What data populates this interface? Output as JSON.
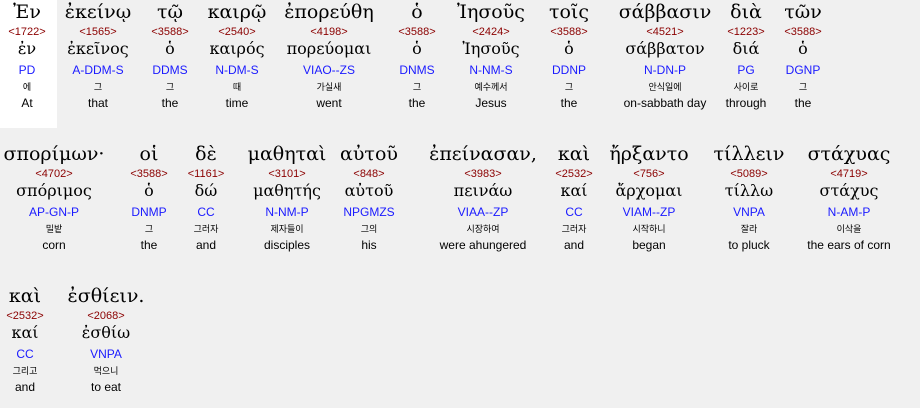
{
  "rows": [
    [
      {
        "greek": "Ἐν",
        "strong": "<1722>",
        "lemma": "ἐν",
        "parse": "PD",
        "korean": "에",
        "english": "At"
      },
      {
        "greek": "ἐκείνῳ",
        "strong": "<1565>",
        "lemma": "ἐκεῖνος",
        "parse": "A-DDM-S",
        "korean": "그",
        "english": "that"
      },
      {
        "greek": "τῷ",
        "strong": "<3588>",
        "lemma": "ὁ",
        "parse": "DDMS",
        "korean": "그",
        "english": "the"
      },
      {
        "greek": "καιρῷ",
        "strong": "<2540>",
        "lemma": "καιρός",
        "parse": "N-DM-S",
        "korean": "때",
        "english": "time"
      },
      {
        "greek": "ἐπορεύθη",
        "strong": "<4198>",
        "lemma": "πορεύομαι",
        "parse": "VIAO--ZS",
        "korean": "가실새",
        "english": "went"
      },
      {
        "greek": "ὁ",
        "strong": "<3588>",
        "lemma": "ὁ",
        "parse": "DNMS",
        "korean": "그",
        "english": "the"
      },
      {
        "greek": "Ἰησοῦς",
        "strong": "<2424>",
        "lemma": "Ἰησοῦς",
        "parse": "N-NM-S",
        "korean": "예수께서",
        "english": "Jesus"
      },
      {
        "greek": "τοῖς",
        "strong": "<3588>",
        "lemma": "ὁ",
        "parse": "DDNP",
        "korean": "그",
        "english": "the"
      },
      {
        "greek": "σάββασιν",
        "strong": "<4521>",
        "lemma": "σάββατον",
        "parse": "N-DN-P",
        "korean": "안식일에",
        "english": "on-sabbath day"
      },
      {
        "greek": "διὰ",
        "strong": "<1223>",
        "lemma": "διά",
        "parse": "PG",
        "korean": "사이로",
        "english": "through"
      },
      {
        "greek": "τῶν",
        "strong": "<3588>",
        "lemma": "ὁ",
        "parse": "DGNP",
        "korean": "그",
        "english": "the"
      }
    ],
    [
      {
        "greek": "σπορίμων·",
        "strong": "<4702>",
        "lemma": "σπόριμος",
        "parse": "AP-GN-P",
        "korean": "밀밭",
        "english": "corn"
      },
      {
        "greek": "οἱ",
        "strong": "<3588>",
        "lemma": "ὁ",
        "parse": "DNMP",
        "korean": "그",
        "english": "the"
      },
      {
        "greek": "δὲ",
        "strong": "<1161>",
        "lemma": "δώ",
        "parse": "CC",
        "korean": "그러자",
        "english": "and"
      },
      {
        "greek": "μαθηταὶ",
        "strong": "<3101>",
        "lemma": "μαθητής",
        "parse": "N-NM-P",
        "korean": "제자들이",
        "english": "disciples"
      },
      {
        "greek": "αὐτοῦ",
        "strong": "<848>",
        "lemma": "αὐτοῦ",
        "parse": "NPGMZS",
        "korean": "그의",
        "english": "his"
      },
      {
        "greek": "ἐπείνασαν,",
        "strong": "<3983>",
        "lemma": "πεινάω",
        "parse": "VIAA--ZP",
        "korean": "시장하여",
        "english": "were ahungered"
      },
      {
        "greek": "καὶ",
        "strong": "<2532>",
        "lemma": "καί",
        "parse": "CC",
        "korean": "그러자",
        "english": "and"
      },
      {
        "greek": "ἤρξαντο",
        "strong": "<756>",
        "lemma": "ἄρχομαι",
        "parse": "VIAM--ZP",
        "korean": "시작하니",
        "english": "began"
      },
      {
        "greek": "τίλλειν",
        "strong": "<5089>",
        "lemma": "τίλλω",
        "parse": "VNPA",
        "korean": "잘라",
        "english": "to pluck"
      },
      {
        "greek": "στάχυας",
        "strong": "<4719>",
        "lemma": "στάχυς",
        "parse": "N-AM-P",
        "korean": "이삭을",
        "english": "the ears of corn"
      }
    ],
    [
      {
        "greek": "καὶ",
        "strong": "<2532>",
        "lemma": "καί",
        "parse": "CC",
        "korean": "그리고",
        "english": "and"
      },
      {
        "greek": "ἐσθίειν.",
        "strong": "<2068>",
        "lemma": "ἐσθίω",
        "parse": "VNPA",
        "korean": "먹으니",
        "english": "to eat"
      }
    ]
  ]
}
